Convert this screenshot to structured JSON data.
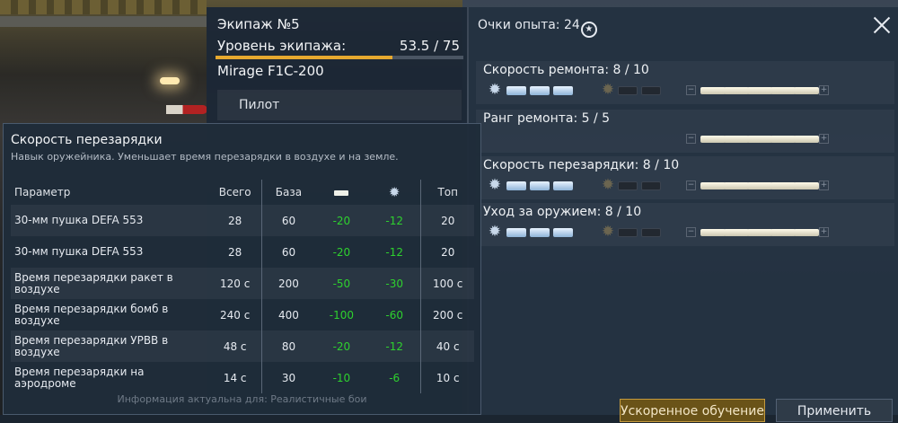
{
  "crew": {
    "title": "Экипаж №5",
    "level_label": "Уровень экипажа:",
    "level_value": "53.5 / 75",
    "level_progress": 0.713,
    "plane": "Mirage F1C-200",
    "role": "Пилот"
  },
  "skills_panel": {
    "xp_label": "Очки опыта: 24",
    "xp_icon": "star-circle-icon",
    "skills": [
      {
        "name": "Скорость ремонта: 8 / 10"
      },
      {
        "name": "Ранг ремонта: 5 / 5"
      },
      {
        "name": "Скорость перезарядки: 8 / 10"
      },
      {
        "name": "Уход за оружием: 8 / 10"
      }
    ]
  },
  "buttons": {
    "accelerated": "Ускоренное обучение",
    "apply": "Применить"
  },
  "tooltip": {
    "title": "Скорость перезарядки",
    "description": "Навык оружейника. Уменьшает время перезарядки в воздухе и на земле.",
    "columns": {
      "param": "Параметр",
      "total": "Всего",
      "base": "База",
      "top": "Топ"
    },
    "rows": [
      {
        "param": "30-мм пушка DEFA 553",
        "total": "28",
        "base": "60",
        "d1": "-20",
        "d2": "-12",
        "top": "20"
      },
      {
        "param": "30-мм пушка DEFA 553",
        "total": "28",
        "base": "60",
        "d1": "-20",
        "d2": "-12",
        "top": "20"
      },
      {
        "param": "Время перезарядки ракет в воздухе",
        "total": "120 с",
        "base": "200",
        "d1": "-50",
        "d2": "-30",
        "top": "100 с"
      },
      {
        "param": "Время перезарядки бомб в воздухе",
        "total": "240 с",
        "base": "400",
        "d1": "-100",
        "d2": "-60",
        "top": "200 с"
      },
      {
        "param": "Время перезарядки УРВВ в воздухе",
        "total": "48 с",
        "base": "80",
        "d1": "-20",
        "d2": "-12",
        "top": "40 с"
      },
      {
        "param": "Время перезарядки на аэродроме",
        "total": "14 с",
        "base": "30",
        "d1": "-10",
        "d2": "-6",
        "top": "10 с"
      }
    ],
    "footer": "Информация актуальна для: Реалистичные бои"
  }
}
